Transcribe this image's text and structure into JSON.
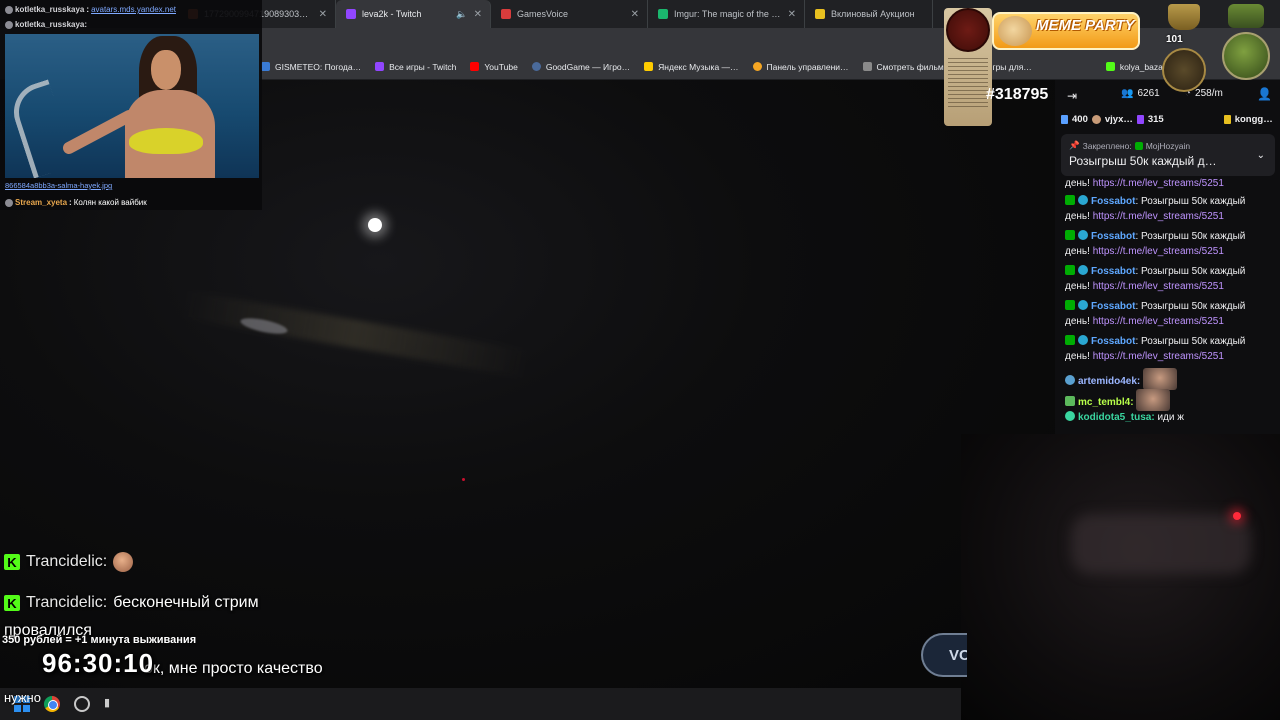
{
  "browser": {
    "tabs": [
      {
        "title": "1772900994719089​3030.png (…",
        "color": "#f26b3a",
        "active": false
      },
      {
        "title": "leva2k - Twitch",
        "color": "#9146ff",
        "active": true,
        "audio": true
      },
      {
        "title": "GamesVoice",
        "color": "#d83c3c",
        "active": false
      },
      {
        "title": "Imgur: The magic of the Intern…",
        "color": "#1bb76e",
        "active": false
      },
      {
        "title": "Вклиновый Аукцион",
        "color": "#e8c020",
        "active": false
      }
    ],
    "bookmarks": [
      {
        "label": "GISMETEO: Погода…",
        "color": "#3a7bd5"
      },
      {
        "label": "Все игры - Twitch",
        "color": "#9146ff"
      },
      {
        "label": "YouTube",
        "color": "#ff0000"
      },
      {
        "label": "GoodGame — Игро…",
        "color": "#4a6a9a"
      },
      {
        "label": "Яндекс Музыка —…",
        "color": "#ffcc00"
      },
      {
        "label": "Панель управлени…",
        "color": "#f5a623"
      },
      {
        "label": "Смотреть фильмы…",
        "color": "#8a8a8a"
      },
      {
        "label": "Игры для…",
        "color": "#c83c3c"
      },
      {
        "label": "kolya_baza3raza Str…",
        "color": "#53fc18"
      }
    ]
  },
  "overlay_chat": {
    "line1_user": "kotletka_russkaya",
    "line1_link": "avatars.mds.yandex.net",
    "line2_user": "kotletka_russkaya:",
    "image_caption": "866584a8bb3a-salma-hayek.jpg",
    "line3_user": "Stream_xyeta",
    "line3_text": "Колян какой вайбик"
  },
  "big_chat": {
    "m1_user": "Trancidelic:",
    "m2_user": "Trancidelic:",
    "m2_text": "бесконечный стрим",
    "m2_text2": "провалился",
    "m3_text": "ок, мне просто качество",
    "m3_text2": "нужно"
  },
  "timer": {
    "subline": "350 рублей = +1 минута выживания",
    "value": "96:30:10"
  },
  "v_button": {
    "label": "VC"
  },
  "counter": {
    "value": "#318795"
  },
  "meme": {
    "label": "MEME PARTY"
  },
  "rank": {
    "value": "101"
  },
  "twitch_chat": {
    "viewers": "6261",
    "rate": "258/m",
    "gifters": [
      {
        "value": "400",
        "color": "#5aa0ff"
      },
      {
        "name": "vjyx…",
        "color": "#e8e8e8"
      },
      {
        "value": "315",
        "color": "#9146ff"
      },
      {
        "name": "kongg…",
        "color": "#e8c020"
      }
    ],
    "pinned_label": "Закреплено:",
    "pinned_by": "MojHozyain",
    "pinned_text": "Розыгрыш 50к каждый д…",
    "partial_prefix": "день!",
    "link": "https://t.me/lev_streams/5251",
    "bot_name": "Fossabot",
    "bot_text": "Розыгрыш 50к каждый",
    "bot_text2": "день!",
    "u1": "artemido4ek:",
    "u2": "mc_tembl4:",
    "u3": "kodidota5_tusa:",
    "u3_text": "иди ж"
  }
}
